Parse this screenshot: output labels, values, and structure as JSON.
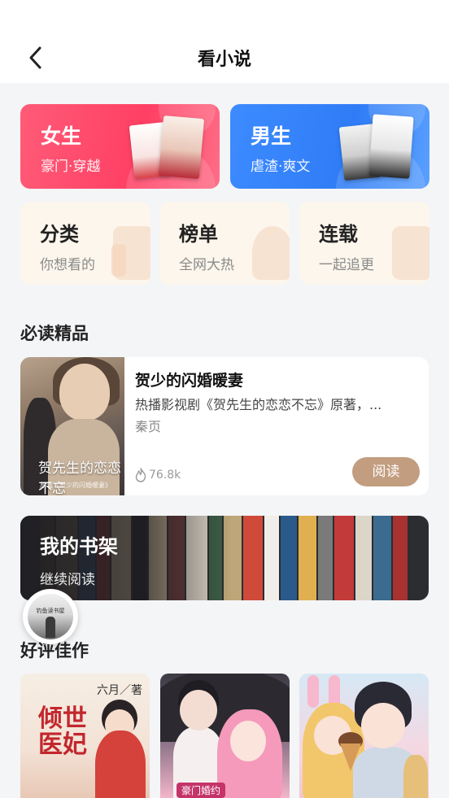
{
  "header": {
    "title": "看小说"
  },
  "gender_cards": {
    "female": {
      "title": "女生",
      "subtitle": "豪门·穿越",
      "accent": "#ff4d6d"
    },
    "male": {
      "title": "男生",
      "subtitle": "虐渣·爽文",
      "accent": "#3a86ff"
    }
  },
  "categories": [
    {
      "title": "分类",
      "subtitle": "你想看的"
    },
    {
      "title": "榜单",
      "subtitle": "全网大热"
    },
    {
      "title": "连载",
      "subtitle": "一起追更"
    }
  ],
  "must_read": {
    "section_title": "必读精品",
    "book": {
      "cover_title": "贺先生的恋恋不忘",
      "cover_caption": "原著《贺少的闪婚暖妻》",
      "title": "贺少的闪婚暖妻",
      "description": "热播影视剧《贺先生的恋恋不忘》原著，...",
      "author": "秦页",
      "heat": "76.8k",
      "read_label": "阅读"
    },
    "read_button_color": "#c29d7f"
  },
  "bookshelf": {
    "title": "我的书架",
    "subtitle": "继续阅读"
  },
  "float_avatar": {
    "caption": "钓鱼读书屋"
  },
  "recommended": {
    "section_title": "好评佳作",
    "books": [
      {
        "cover_text": "倾世医妃",
        "author_tag": "六月／著"
      },
      {
        "cover_text": "豪门婚约"
      },
      {
        "cover_text": ""
      }
    ]
  }
}
